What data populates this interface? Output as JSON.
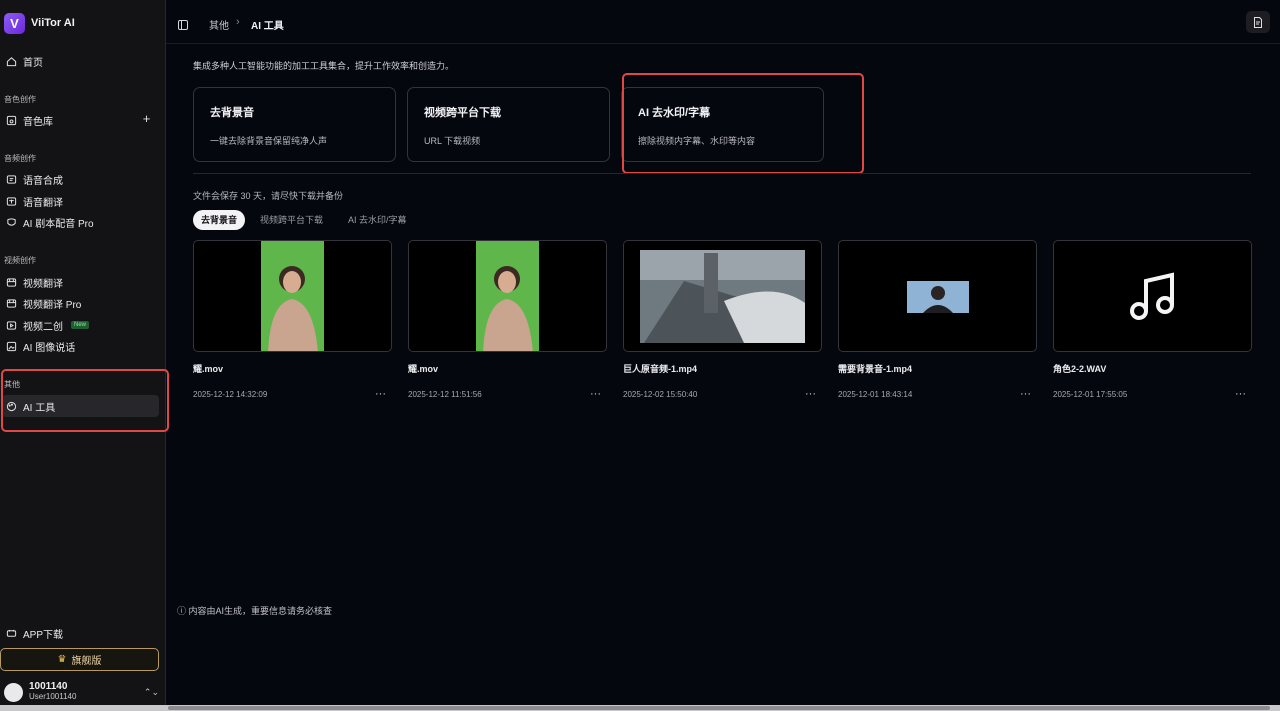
{
  "app": {
    "name": "ViiTor AI",
    "logo_letter": "V"
  },
  "sidebar": {
    "home_label": "首页",
    "sections": {
      "voice": "音色创作",
      "audio": "音频创作",
      "video": "视频创作",
      "other": "其他"
    },
    "voice_items": [
      "音色库"
    ],
    "audio_items": [
      "语音合成",
      "语音翻译",
      "AI 剧本配音 Pro"
    ],
    "video_items": [
      "视频翻译",
      "视频翻译 Pro",
      "视频二创",
      "AI 图像说话"
    ],
    "new_badge": "New",
    "other_items": [
      "AI 工具"
    ],
    "app_download": "APP下载",
    "vip_label": "旗舰版",
    "user": {
      "name": "1001140",
      "sub": "User1001140"
    }
  },
  "breadcrumb": {
    "parent": "其他",
    "current": "AI 工具"
  },
  "main": {
    "description": "集成多种人工智能功能的加工工具集合，提升工作效率和创造力。",
    "tools": [
      {
        "title": "去背景音",
        "desc": "一键去除背景音保留纯净人声"
      },
      {
        "title": "视频跨平台下载",
        "desc": "URL 下载视频"
      },
      {
        "title": "AI 去水印/字幕",
        "desc": "擦除视频内字幕、水印等内容"
      }
    ],
    "keep_note": "文件会保存 30 天，请尽快下载并备份",
    "filter_tabs": [
      "去背景音",
      "视频跨平台下载",
      "AI 去水印/字幕"
    ],
    "files": [
      {
        "name": "耀.mov",
        "time": "2025-12-12 14:32:09",
        "thumb": "portrait-green"
      },
      {
        "name": "耀.mov",
        "time": "2025-12-12 11:51:56",
        "thumb": "portrait-green"
      },
      {
        "name": "巨人原音频-1.mp4",
        "time": "2025-12-02 15:50:40",
        "thumb": "anime-still"
      },
      {
        "name": "需要背景音-1.mp4",
        "time": "2025-12-01 18:43:14",
        "thumb": "small-person"
      },
      {
        "name": "角色2-2.WAV",
        "time": "2025-12-01 17:55:05",
        "thumb": "music-note-icon"
      }
    ],
    "more_glyph": "···",
    "footer_note": "ⓘ 内容由AI生成，重要信息请务必核查"
  },
  "colors": {
    "accent": "#7c3aed",
    "highlight": "#e04848",
    "background": "#05070f",
    "sidebar": "#131316"
  }
}
